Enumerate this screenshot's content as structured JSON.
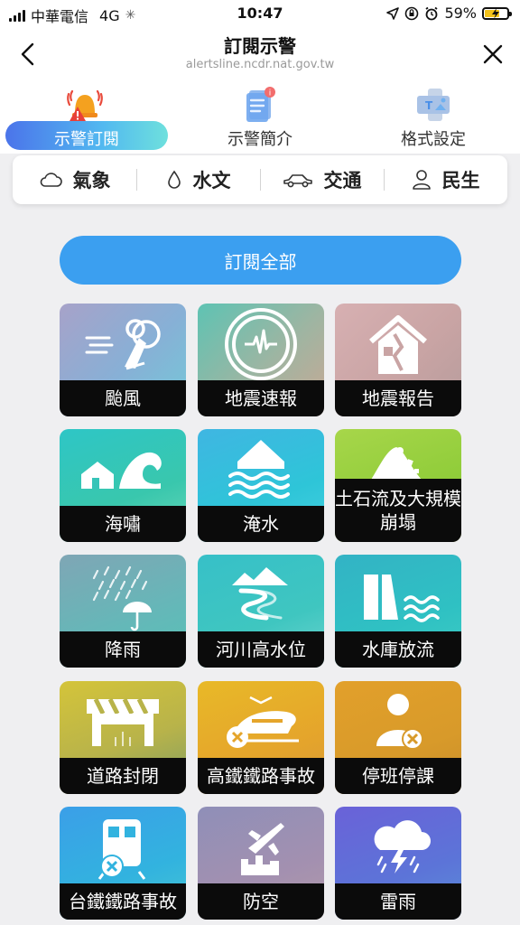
{
  "status_bar": {
    "carrier": "中華電信",
    "network": "4G",
    "time": "10:47",
    "battery": "59%"
  },
  "header": {
    "title": "訂閱示警",
    "url": "alertsline.ncdr.nat.gov.tw"
  },
  "tabs": [
    {
      "label": "示警訂閱",
      "icon": "alarm-bell-icon",
      "active": true
    },
    {
      "label": "示警簡介",
      "icon": "document-icon",
      "active": false
    },
    {
      "label": "格式設定",
      "icon": "format-icon",
      "active": false
    }
  ],
  "categories": [
    {
      "label": "氣象",
      "icon": "cloud-icon"
    },
    {
      "label": "水文",
      "icon": "water-drop-icon"
    },
    {
      "label": "交通",
      "icon": "car-icon"
    },
    {
      "label": "民生",
      "icon": "person-icon"
    }
  ],
  "subscribe_all": "訂閱全部",
  "tiles": [
    {
      "label": "颱風",
      "icon": "typhoon-icon"
    },
    {
      "label": "地震速報",
      "icon": "seismograph-icon"
    },
    {
      "label": "地震報告",
      "icon": "damaged-house-icon"
    },
    {
      "label": "海嘯",
      "icon": "tsunami-icon"
    },
    {
      "label": "淹水",
      "icon": "flood-icon"
    },
    {
      "label": "土石流及大規模崩塌",
      "icon": "landslide-icon"
    },
    {
      "label": "降雨",
      "icon": "rain-umbrella-icon"
    },
    {
      "label": "河川高水位",
      "icon": "river-icon"
    },
    {
      "label": "水庫放流",
      "icon": "reservoir-icon"
    },
    {
      "label": "道路封閉",
      "icon": "road-barrier-icon"
    },
    {
      "label": "高鐵鐵路事故",
      "icon": "high-speed-rail-icon"
    },
    {
      "label": "停班停課",
      "icon": "office-closure-icon"
    },
    {
      "label": "台鐵鐵路事故",
      "icon": "train-icon"
    },
    {
      "label": "防空",
      "icon": "air-defense-icon"
    },
    {
      "label": "雷雨",
      "icon": "thunderstorm-icon"
    }
  ],
  "colors": {
    "accent": "#3b9ff0",
    "tab_gradient_start": "#4b74ea",
    "tab_gradient_end": "#6ee0dd"
  }
}
